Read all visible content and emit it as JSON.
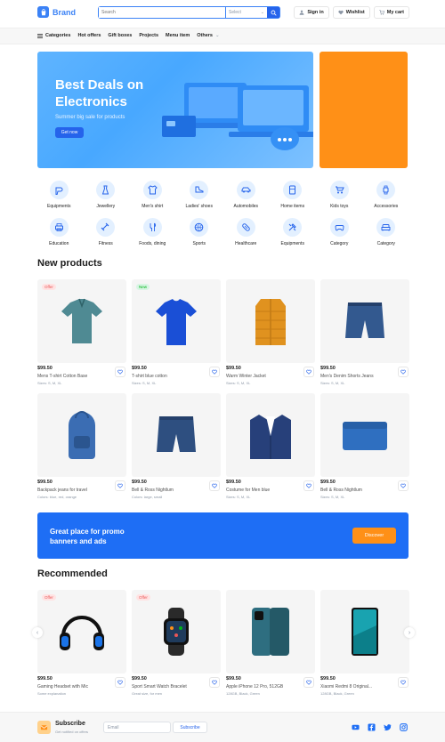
{
  "header": {
    "brand": "Brand",
    "search_placeholder": "Search",
    "select_label": "Select",
    "actions": [
      {
        "label": "Sign in",
        "icon": "user-icon"
      },
      {
        "label": "Wishlist",
        "icon": "heart-icon"
      },
      {
        "label": "My cart",
        "icon": "cart-icon"
      }
    ]
  },
  "nav": {
    "items": [
      "Categories",
      "Hot offers",
      "Gift boxes",
      "Projects",
      "Menu item",
      "Others"
    ]
  },
  "banner": {
    "title": "Best Deals on Electronics",
    "subtitle": "Summer big sale for products",
    "cta": "Get now"
  },
  "categories": [
    {
      "label": "Equipments",
      "icon": "hairdryer-icon"
    },
    {
      "label": "Jewellery",
      "icon": "dress-icon"
    },
    {
      "label": "Men's shirt",
      "icon": "shirt-icon"
    },
    {
      "label": "Ladies' shoes",
      "icon": "shoe-icon"
    },
    {
      "label": "Automobiles",
      "icon": "car-icon"
    },
    {
      "label": "Home items",
      "icon": "fridge-icon"
    },
    {
      "label": "Kids toys",
      "icon": "stroller-icon"
    },
    {
      "label": "Accessories",
      "icon": "watch-icon"
    },
    {
      "label": "Education",
      "icon": "printer-icon"
    },
    {
      "label": "Fitness",
      "icon": "dumbbell-icon"
    },
    {
      "label": "Foods, dining",
      "icon": "food-icon"
    },
    {
      "label": "Sports",
      "icon": "basketball-icon"
    },
    {
      "label": "Healthcare",
      "icon": "pill-icon"
    },
    {
      "label": "Equipments",
      "icon": "tools-icon"
    },
    {
      "label": "Category",
      "icon": "gamepad-icon"
    },
    {
      "label": "Category",
      "icon": "sofa-icon"
    }
  ],
  "new_products": {
    "title": "New products",
    "items": [
      {
        "price": "$99.50",
        "name": "Mens T-shirt Cotton Base",
        "meta": "Sizes: S, M, XL",
        "badge": "Offer",
        "badge_type": "offer",
        "kind": "polo",
        "color": "#4f8a93"
      },
      {
        "price": "$99.50",
        "name": "T-shirt blue cotton",
        "meta": "Sizes: S, M, XL",
        "badge": "New",
        "badge_type": "new",
        "kind": "tshirt",
        "color": "#1a4fd6"
      },
      {
        "price": "$99.50",
        "name": "Warm Winter Jacket",
        "meta": "Sizes: S, M, XL",
        "badge": "",
        "badge_type": "",
        "kind": "jacket",
        "color": "#e0921f"
      },
      {
        "price": "$99.50",
        "name": "Men's Denim Shorts Jeans",
        "meta": "Sizes: S, M, XL",
        "badge": "",
        "badge_type": "",
        "kind": "shorts",
        "color": "#33598f"
      },
      {
        "price": "$99.50",
        "name": "Backpack jeans for travel",
        "meta": "Colors: blue, red, orange",
        "badge": "",
        "badge_type": "",
        "kind": "backpack",
        "color": "#3b6db3"
      },
      {
        "price": "$99.50",
        "name": "Bell & Ross Nightlum",
        "meta": "Colors: large, small",
        "badge": "",
        "badge_type": "",
        "kind": "shorts",
        "color": "#2e4f80"
      },
      {
        "price": "$99.50",
        "name": "Costume for Men blue",
        "meta": "Sizes: S, M, XL",
        "badge": "",
        "badge_type": "",
        "kind": "suit",
        "color": "#27407a"
      },
      {
        "price": "$99.50",
        "name": "Bell & Ross Nightlum",
        "meta": "Sizes: S, M, XL",
        "badge": "",
        "badge_type": "",
        "kind": "wallet",
        "color": "#2f6fc0"
      }
    ]
  },
  "promo": {
    "text": "Great place for promo banners and ads",
    "cta": "Discover"
  },
  "recommended": {
    "title": "Recommended",
    "items": [
      {
        "price": "$99.50",
        "name": "Gaming Headset with Mic",
        "meta": "Some explanation",
        "badge": "Offer",
        "badge_type": "offer",
        "kind": "headset",
        "color": "#1a73e8"
      },
      {
        "price": "$99.50",
        "name": "Sport Smart Watch Bracelet",
        "meta": "Great size, for men",
        "badge": "Offer",
        "badge_type": "offer",
        "kind": "smartwatch",
        "color": "#222222"
      },
      {
        "price": "$99.50",
        "name": "Apple iPhone 12 Pro, 512GB",
        "meta": "128GB, Black, Green",
        "badge": "",
        "badge_type": "",
        "kind": "iphone",
        "color": "#2e6e80"
      },
      {
        "price": "$99.50",
        "name": "Xiaomi Redmi 8 Original...",
        "meta": "128GB, Black, Green",
        "badge": "",
        "badge_type": "",
        "kind": "android",
        "color": "#19a3b0"
      }
    ]
  },
  "footer": {
    "subscribe_title": "Subscribe",
    "subscribe_sub": "Get notified on offers",
    "email_placeholder": "Email",
    "subscribe_button": "Subscribe",
    "socials": [
      "youtube-icon",
      "facebook-icon",
      "twitter-icon",
      "instagram-icon"
    ]
  }
}
